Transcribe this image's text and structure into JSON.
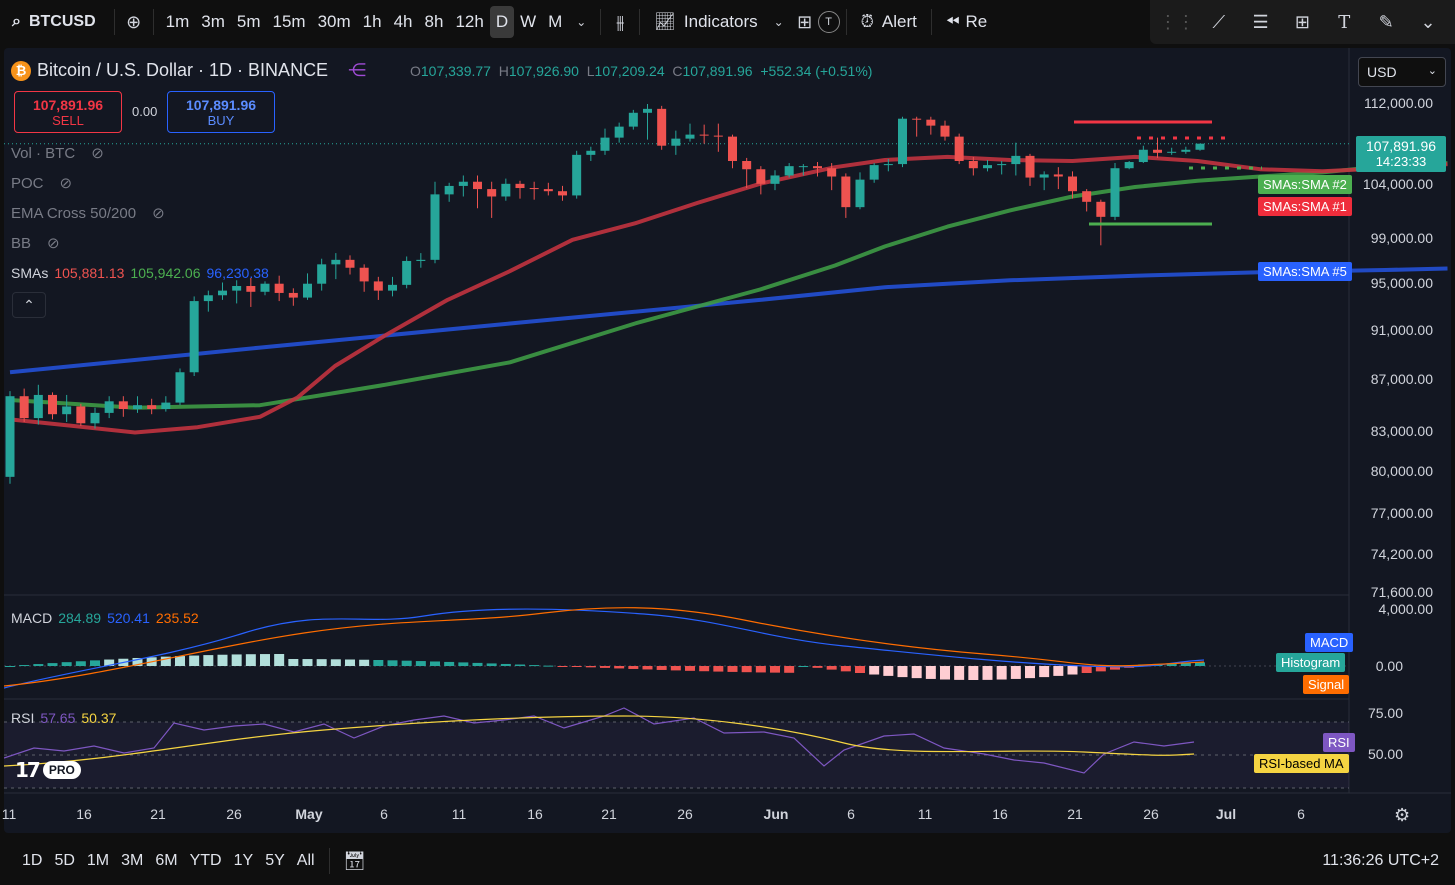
{
  "toolbar": {
    "symbol": "BTCUSD",
    "intervals": [
      "1m",
      "3m",
      "5m",
      "15m",
      "30m",
      "1h",
      "4h",
      "8h",
      "12h",
      "D",
      "W",
      "M"
    ],
    "active_interval": "D",
    "indicators_label": "Indicators",
    "alert_label": "Alert",
    "replay_label": "Re",
    "t_badge": "T"
  },
  "header": {
    "title": "Bitcoin / U.S. Dollar · 1D · BINANCE",
    "ohlc": {
      "o_label": "O",
      "o": "107,339.77",
      "h_label": "H",
      "h": "107,926.90",
      "l_label": "L",
      "l": "107,209.24",
      "c_label": "C",
      "c": "107,891.96",
      "change": "+552.34 (+0.51%)"
    },
    "currency": "USD"
  },
  "trade": {
    "sell_price": "107,891.96",
    "sell_label": "SELL",
    "spread": "0.00",
    "buy_price": "107,891.96",
    "buy_label": "BUY"
  },
  "indicators": {
    "vol": "Vol · BTC",
    "poc": "POC",
    "ema": "EMA Cross 50/200",
    "bb": "BB",
    "smas_label": "SMAs",
    "sma1": "105,881.13",
    "sma2": "105,942.06",
    "sma5": "96,230.38"
  },
  "price_axis": [
    "112,000.00",
    "104,000.00",
    "99,000.00",
    "95,000.00",
    "91,000.00",
    "87,000.00",
    "83,000.00",
    "80,000.00",
    "77,000.00",
    "74,200.00",
    "71,600.00"
  ],
  "last_price": {
    "value": "107,891.96",
    "countdown": "14:23:33"
  },
  "tags": {
    "sma2": "SMAs:SMA #2",
    "sma1": "SMAs:SMA #1",
    "sma5": "SMAs:SMA #5",
    "macd": "MACD",
    "hist": "Histogram",
    "signal": "Signal",
    "rsi": "RSI",
    "rsi_ma": "RSI-based MA"
  },
  "macd": {
    "label": "MACD",
    "v1": "284.89",
    "v2": "520.41",
    "v3": "235.52",
    "axis_top": "4,000.00",
    "axis_zero": "0.00"
  },
  "rsi": {
    "label": "RSI",
    "v1": "57.65",
    "v2": "50.37",
    "axis_75": "75.00",
    "axis_50": "50.00"
  },
  "time_axis": [
    "11",
    "16",
    "21",
    "26",
    "May",
    "6",
    "11",
    "16",
    "21",
    "26",
    "Jun",
    "6",
    "11",
    "16",
    "21",
    "26",
    "Jul",
    "6"
  ],
  "bottom": {
    "ranges": [
      "1D",
      "5D",
      "1M",
      "3M",
      "6M",
      "YTD",
      "1Y",
      "5Y",
      "All"
    ],
    "clock": "11:36:26 UTC+2"
  },
  "logo_text": "PRO",
  "colors": {
    "up": "#26a69a",
    "down": "#ef5350",
    "sma1": "#c2333f",
    "sma2": "#3e9a45",
    "sma5": "#2450d6",
    "bg": "#131722"
  },
  "chart_data": {
    "type": "candlestick",
    "y_range": [
      71600,
      112500
    ],
    "candles": [
      [
        79500,
        85600,
        79000,
        86000
      ],
      [
        85600,
        83900,
        83600,
        86200
      ],
      [
        83900,
        85700,
        83400,
        86500
      ],
      [
        85700,
        84200,
        83800,
        85900
      ],
      [
        84200,
        84800,
        83600,
        85700
      ],
      [
        84800,
        83500,
        83300,
        85000
      ],
      [
        83500,
        84300,
        83100,
        84700
      ],
      [
        84300,
        85200,
        83900,
        85600
      ],
      [
        85200,
        84600,
        84000,
        85600
      ],
      [
        84600,
        84900,
        84300,
        85600
      ],
      [
        84900,
        84600,
        84200,
        85400
      ],
      [
        84600,
        85100,
        84400,
        85600
      ],
      [
        85100,
        87500,
        84900,
        87800
      ],
      [
        87500,
        93400,
        87200,
        93800
      ],
      [
        93400,
        93900,
        92500,
        94300
      ],
      [
        93900,
        94300,
        93500,
        95000
      ],
      [
        94300,
        94700,
        93200,
        95200
      ],
      [
        94700,
        94200,
        92900,
        95400
      ],
      [
        94200,
        94900,
        93900,
        95100
      ],
      [
        94900,
        94100,
        93400,
        95600
      ],
      [
        94100,
        93700,
        93000,
        94500
      ],
      [
        93700,
        94900,
        93500,
        95800
      ],
      [
        94900,
        96600,
        94300,
        97100
      ],
      [
        96600,
        97000,
        95300,
        97600
      ],
      [
        97000,
        96300,
        95700,
        97400
      ],
      [
        96300,
        95100,
        94200,
        96600
      ],
      [
        95100,
        94300,
        93500,
        95500
      ],
      [
        94300,
        94800,
        93800,
        95500
      ],
      [
        94800,
        96900,
        94500,
        97300
      ],
      [
        96900,
        97000,
        96300,
        97600
      ],
      [
        97000,
        103000,
        96700,
        104200
      ],
      [
        103000,
        103800,
        102300,
        104100
      ],
      [
        103800,
        104200,
        102800,
        104800
      ],
      [
        104200,
        103500,
        101700,
        104800
      ],
      [
        103500,
        102800,
        100800,
        104200
      ],
      [
        102800,
        104000,
        102400,
        104500
      ],
      [
        104000,
        103600,
        102600,
        104300
      ],
      [
        103600,
        103500,
        102500,
        104200
      ],
      [
        103500,
        103300,
        102900,
        104100
      ],
      [
        103300,
        102900,
        102400,
        103800
      ],
      [
        102900,
        106800,
        102600,
        107200
      ],
      [
        106800,
        107200,
        106200,
        107600
      ],
      [
        107200,
        108500,
        106800,
        109400
      ],
      [
        108500,
        109600,
        108000,
        110000
      ],
      [
        109600,
        111000,
        109300,
        111300
      ],
      [
        111000,
        111400,
        108300,
        111900
      ],
      [
        111400,
        107700,
        107300,
        111700
      ],
      [
        107700,
        108400,
        106800,
        109200
      ],
      [
        108400,
        108800,
        108100,
        109900
      ],
      [
        108800,
        108700,
        107900,
        109800
      ],
      [
        108700,
        108600,
        107100,
        109900
      ],
      [
        108600,
        106200,
        105500,
        108800
      ],
      [
        106200,
        105400,
        103600,
        106500
      ],
      [
        105400,
        104000,
        103000,
        105700
      ],
      [
        104000,
        104800,
        103400,
        105300
      ],
      [
        104800,
        105700,
        104600,
        106000
      ],
      [
        105700,
        105700,
        104800,
        105900
      ],
      [
        105700,
        105500,
        104700,
        106100
      ],
      [
        105500,
        104700,
        103400,
        106000
      ],
      [
        104700,
        101800,
        100800,
        105000
      ],
      [
        101800,
        104400,
        101600,
        105100
      ],
      [
        104400,
        105800,
        104100,
        106000
      ],
      [
        105800,
        105900,
        105200,
        106400
      ],
      [
        105900,
        110400,
        105600,
        110600
      ],
      [
        110400,
        110300,
        108600,
        110600
      ],
      [
        110300,
        109700,
        108800,
        110600
      ],
      [
        109700,
        108600,
        108200,
        110200
      ],
      [
        108600,
        106200,
        105900,
        108900
      ],
      [
        106200,
        105500,
        104800,
        106600
      ],
      [
        105500,
        105800,
        105200,
        106300
      ],
      [
        105800,
        105900,
        104900,
        106200
      ],
      [
        105900,
        106700,
        104800,
        108000
      ],
      [
        106700,
        104600,
        103800,
        106900
      ],
      [
        104600,
        104900,
        103400,
        105200
      ],
      [
        104900,
        104700,
        103500,
        105600
      ],
      [
        104700,
        103300,
        102600,
        105200
      ],
      [
        103300,
        102300,
        101400,
        103500
      ],
      [
        102300,
        100900,
        98300,
        102500
      ],
      [
        100900,
        105500,
        100600,
        106000
      ],
      [
        105500,
        106100,
        105400,
        106200
      ],
      [
        106100,
        107300,
        106000,
        107700
      ],
      [
        107300,
        107000,
        106500,
        108500
      ],
      [
        107000,
        107100,
        106800,
        107500
      ],
      [
        107100,
        107300,
        106900,
        107600
      ],
      [
        107300,
        107900,
        107200,
        107900
      ]
    ],
    "sma1": [
      [
        0,
        83800
      ],
      [
        5,
        83300
      ],
      [
        10,
        82800
      ],
      [
        15,
        83200
      ],
      [
        20,
        84000
      ],
      [
        23,
        85500
      ],
      [
        26,
        88000
      ],
      [
        30,
        90500
      ],
      [
        35,
        93500
      ],
      [
        40,
        96000
      ],
      [
        45,
        98800
      ],
      [
        50,
        100300
      ],
      [
        55,
        102200
      ],
      [
        60,
        104000
      ],
      [
        66,
        105600
      ],
      [
        70,
        106300
      ],
      [
        75,
        106600
      ],
      [
        80,
        106300
      ],
      [
        85,
        106200
      ],
      [
        90,
        106600
      ],
      [
        95,
        106200
      ],
      [
        100,
        105400
      ],
      [
        105,
        105200
      ],
      [
        110,
        105500
      ],
      [
        115,
        105900
      ]
    ],
    "sma2": [
      [
        0,
        85300
      ],
      [
        10,
        84700
      ],
      [
        20,
        84900
      ],
      [
        30,
        86500
      ],
      [
        40,
        88300
      ],
      [
        50,
        91500
      ],
      [
        60,
        94400
      ],
      [
        66,
        96500
      ],
      [
        70,
        98200
      ],
      [
        75,
        100000
      ],
      [
        80,
        101500
      ],
      [
        85,
        102800
      ],
      [
        90,
        103700
      ],
      [
        95,
        104300
      ],
      [
        100,
        104700
      ],
      [
        105,
        105100
      ],
      [
        110,
        105700
      ],
      [
        115,
        106000
      ]
    ],
    "sma5": [
      [
        0,
        87500
      ],
      [
        20,
        89500
      ],
      [
        40,
        91500
      ],
      [
        60,
        93500
      ],
      [
        70,
        94600
      ],
      [
        80,
        95200
      ],
      [
        90,
        95600
      ],
      [
        100,
        95900
      ],
      [
        110,
        96100
      ],
      [
        115,
        96230
      ]
    ]
  }
}
